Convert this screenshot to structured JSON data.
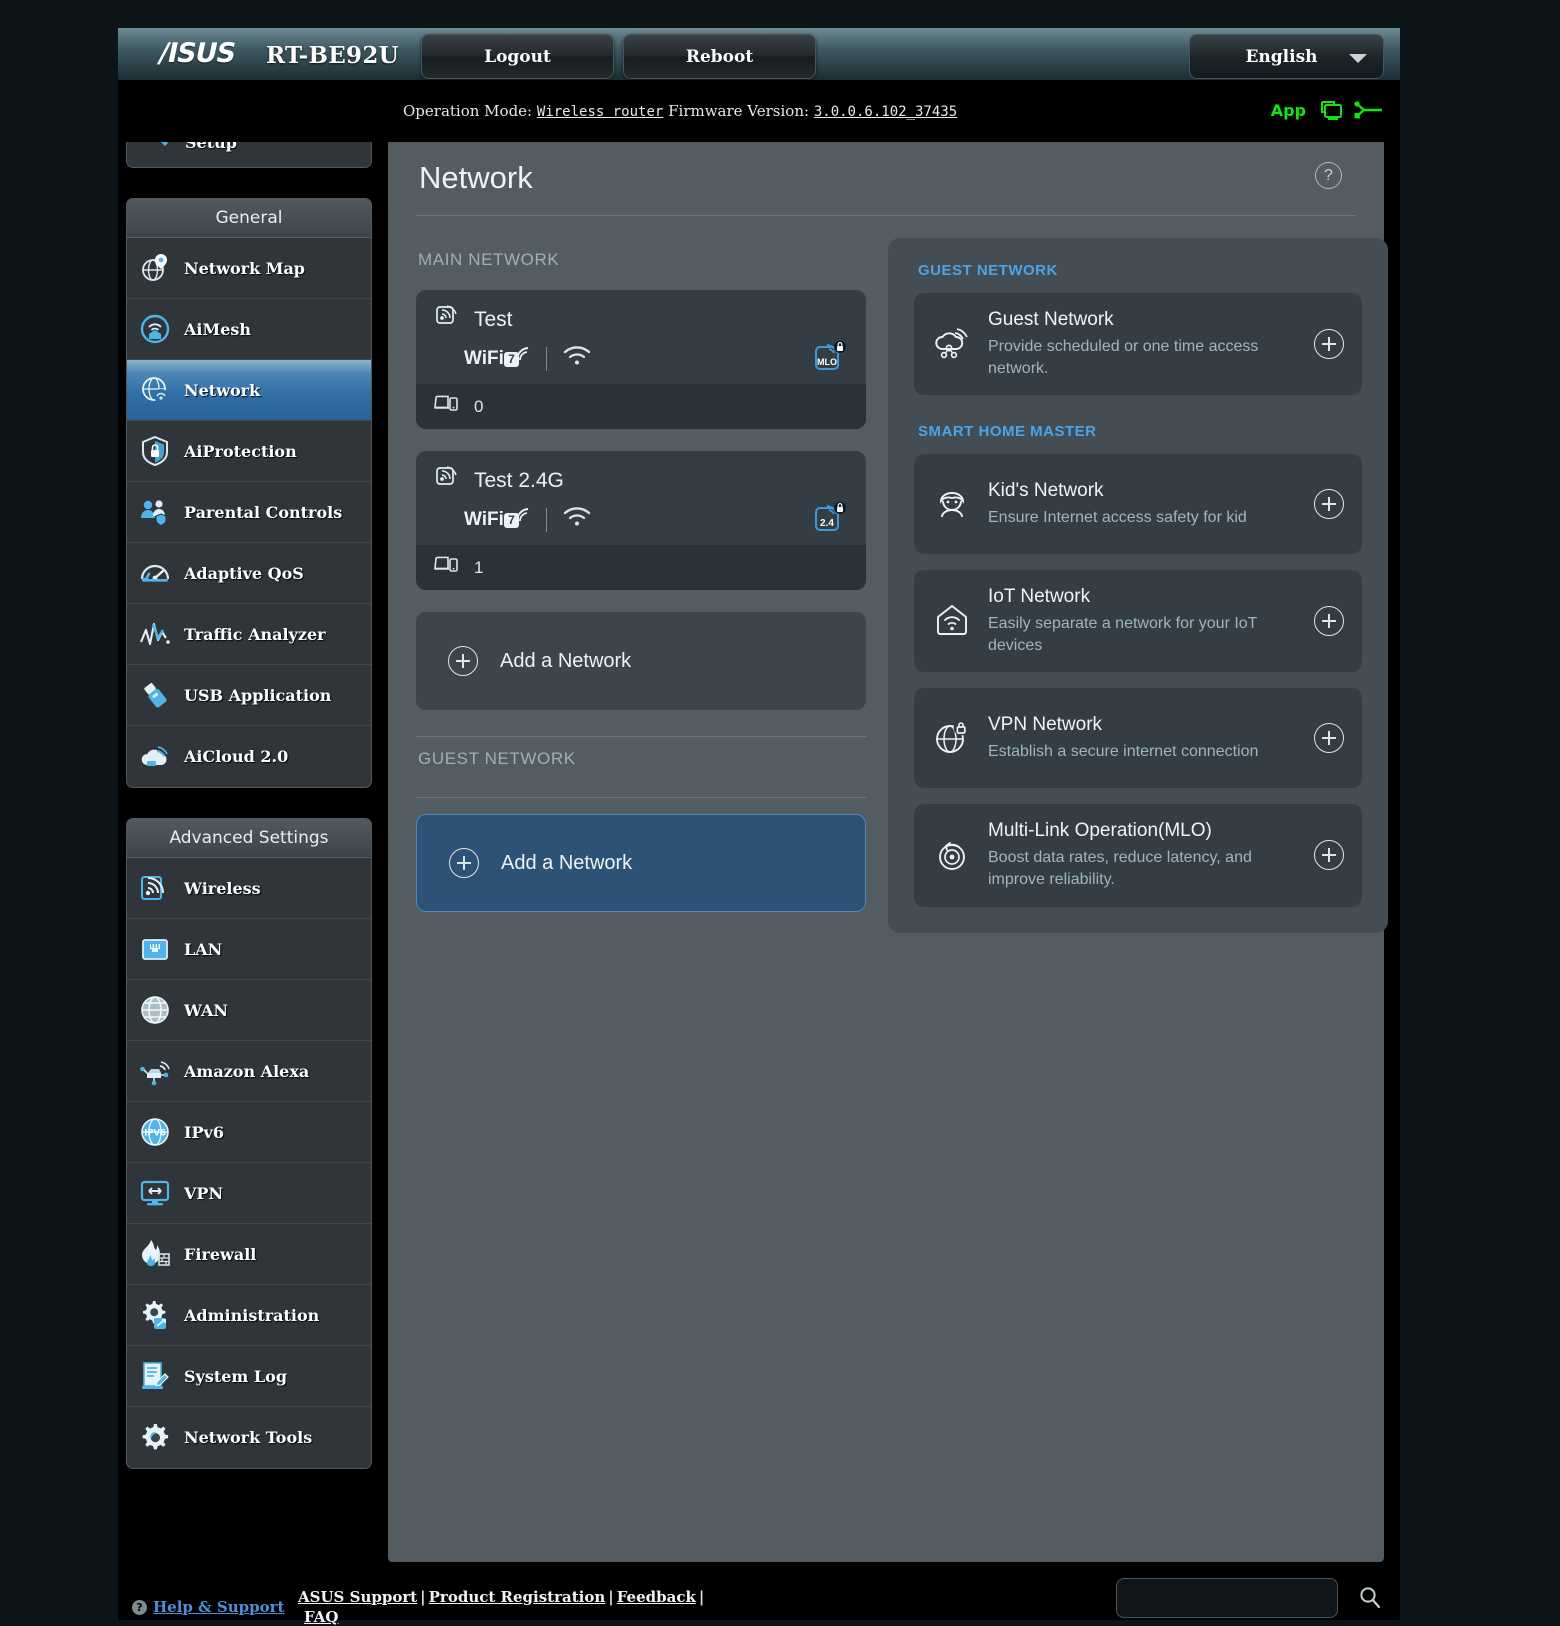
{
  "header": {
    "brand": "/ISUS",
    "model": "RT-BE92U",
    "logout_label": "Logout",
    "reboot_label": "Reboot",
    "language": "English"
  },
  "infobar": {
    "operation_mode_label": "Operation Mode:",
    "operation_mode_value": "Wireless router",
    "firmware_label": "Firmware Version:",
    "firmware_value": "3.0.0.6.102_37435",
    "app_label": "App"
  },
  "sidebar": {
    "quick_setup": "Quick Internet Setup",
    "general_header": "General",
    "general_items": [
      {
        "label": "Network Map",
        "icon": "network-map-icon"
      },
      {
        "label": "AiMesh",
        "icon": "aimesh-icon"
      },
      {
        "label": "Network",
        "icon": "network-icon",
        "active": true
      },
      {
        "label": "AiProtection",
        "icon": "shield-lock-icon"
      },
      {
        "label": "Parental Controls",
        "icon": "parental-controls-icon"
      },
      {
        "label": "Adaptive QoS",
        "icon": "gauge-icon"
      },
      {
        "label": "Traffic Analyzer",
        "icon": "traffic-analyzer-icon"
      },
      {
        "label": "USB Application",
        "icon": "usb-icon"
      },
      {
        "label": "AiCloud 2.0",
        "icon": "cloud-icon"
      }
    ],
    "advanced_header": "Advanced Settings",
    "advanced_items": [
      {
        "label": "Wireless",
        "icon": "wireless-icon"
      },
      {
        "label": "LAN",
        "icon": "lan-port-icon"
      },
      {
        "label": "WAN",
        "icon": "globe-icon"
      },
      {
        "label": "Amazon Alexa",
        "icon": "alexa-icon"
      },
      {
        "label": "IPv6",
        "icon": "ipv6-icon"
      },
      {
        "label": "VPN",
        "icon": "vpn-monitor-icon"
      },
      {
        "label": "Firewall",
        "icon": "firewall-flame-icon"
      },
      {
        "label": "Administration",
        "icon": "gear-wrench-icon"
      },
      {
        "label": "System Log",
        "icon": "system-log-icon"
      },
      {
        "label": "Network Tools",
        "icon": "network-tools-icon"
      }
    ]
  },
  "page": {
    "title": "Network",
    "help_glyph": "?"
  },
  "main_network": {
    "section_label": "MAIN NETWORK",
    "cards": [
      {
        "name": "Test",
        "wifi_std": "WiFi",
        "wifi_gen": "7",
        "band_badge": "MLO",
        "device_count": "0"
      },
      {
        "name": "Test 2.4G",
        "wifi_std": "WiFi",
        "wifi_gen": "7",
        "band_badge": "2.4",
        "device_count": "1"
      }
    ],
    "add_label": "Add a Network"
  },
  "guest_network_left": {
    "section_label": "GUEST NETWORK",
    "add_label": "Add a Network"
  },
  "right_panel": {
    "guest_section_label": "GUEST NETWORK",
    "guest_cards": [
      {
        "title": "Guest Network",
        "desc": "Provide scheduled or one time access network.",
        "icon": "guest-network-icon"
      }
    ],
    "smart_section_label": "SMART HOME MASTER",
    "smart_cards": [
      {
        "title": "Kid's Network",
        "desc": "Ensure Internet access safety for kid",
        "icon": "kids-network-icon"
      },
      {
        "title": "IoT Network",
        "desc": "Easily separate a network for your IoT devices",
        "icon": "iot-network-icon"
      },
      {
        "title": "VPN Network",
        "desc": "Establish a secure internet connection",
        "icon": "vpn-network-icon"
      },
      {
        "title": "Multi-Link Operation(MLO)",
        "desc": "Boost data rates, reduce latency, and improve reliability.",
        "icon": "mlo-icon"
      }
    ]
  },
  "footer": {
    "help_support": "Help & Support",
    "asus_support": "ASUS Support",
    "product_registration": "Product Registration",
    "feedback": "Feedback",
    "faq": "FAQ",
    "search_placeholder": ""
  },
  "colors": {
    "accent_blue": "#4da3e8",
    "active_nav": "#2e6da4",
    "app_green": "#13e313",
    "card_bg": "#333d43",
    "panel_bg": "#525c61"
  }
}
